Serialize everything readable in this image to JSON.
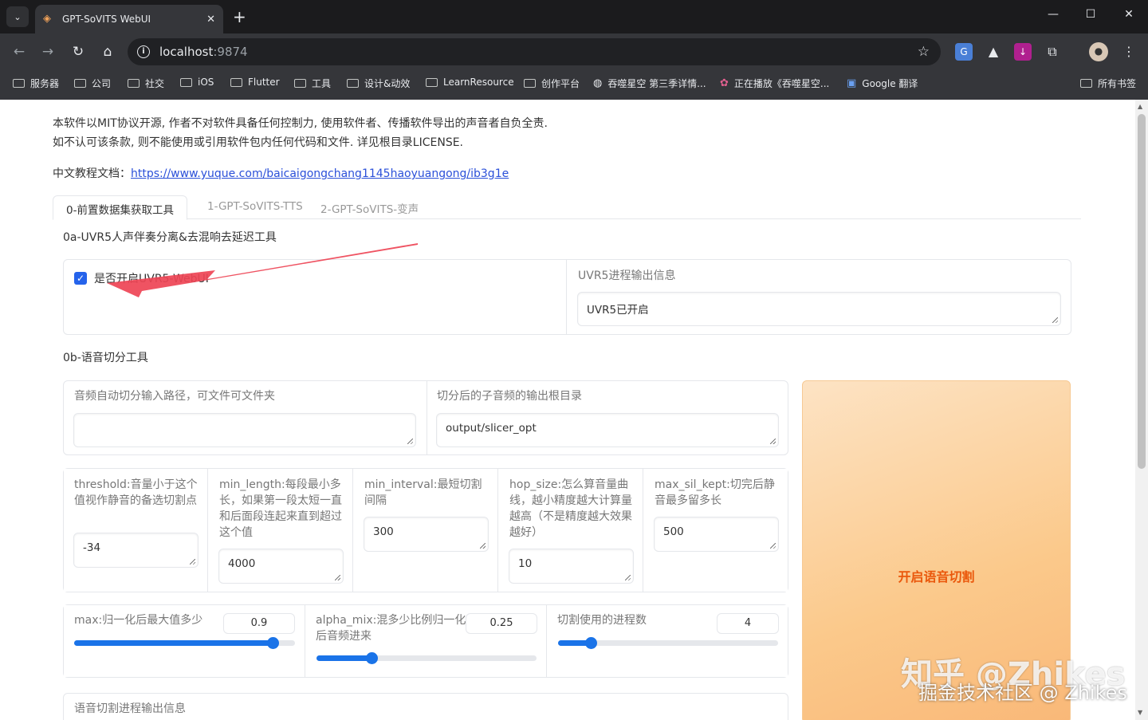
{
  "browser": {
    "tab_title": "GPT-SoVITS WebUI",
    "url_host": "localhost",
    "url_port": ":9874",
    "bookmarks": [
      "服务器",
      "公司",
      "社交",
      "iOS",
      "Flutter",
      "工具",
      "设计&动效",
      "LearnResource",
      "创作平台",
      "吞噬星空 第三季详情...",
      "正在播放《吞噬星空...",
      "Google 翻译"
    ],
    "all_bookmarks": "所有书签"
  },
  "page": {
    "license_line1": "本软件以MIT协议开源, 作者不对软件具备任何控制力, 使用软件者、传播软件导出的声音者自负全责.",
    "license_line2": "如不认可该条款, 则不能使用或引用软件包内任何代码和文件. 详见根目录LICENSE.",
    "doc_label": "中文教程文档：",
    "doc_link": "https://www.yuque.com/baicaigongchang1145haoyuangong/ib3g1e",
    "tabs": [
      "0-前置数据集获取工具",
      "1-GPT-SoVITS-TTS",
      "2-GPT-SoVITS-变声"
    ],
    "uvr": {
      "section_title": "0a-UVR5人声伴奏分离&去混响去延迟工具",
      "checkbox_label": "是否开启UVR5-WebUI",
      "output_label": "UVR5进程输出信息",
      "output_value": "UVR5已开启"
    },
    "slicer": {
      "section_title": "0b-语音切分工具",
      "input_path_label": "音频自动切分输入路径，可文件可文件夹",
      "input_path_value": "",
      "output_dir_label": "切分后的子音频的输出根目录",
      "output_dir_value": "output/slicer_opt",
      "params": [
        {
          "label": "threshold:音量小于这个值视作静音的备选切割点",
          "value": "-34"
        },
        {
          "label": "min_length:每段最小多长，如果第一段太短一直和后面段连起来直到超过这个值",
          "value": "4000"
        },
        {
          "label": "min_interval:最短切割间隔",
          "value": "300"
        },
        {
          "label": "hop_size:怎么算音量曲线，越小精度越大计算量越高（不是精度越大效果越好）",
          "value": "10"
        },
        {
          "label": "max_sil_kept:切完后静音最多留多长",
          "value": "500"
        }
      ],
      "sliders": [
        {
          "label": "max:归一化后最大值多少",
          "value": "0.9",
          "fraction": 0.9
        },
        {
          "label": "alpha_mix:混多少比例归一化后音频进来",
          "value": "0.25",
          "fraction": 0.25
        },
        {
          "label": "切割使用的进程数",
          "value": "4",
          "fraction": 0.15
        }
      ],
      "start_button": "开启语音切割",
      "progress_label": "语音切割进程输出信息"
    },
    "watermark_1": "知乎 @Zhikes",
    "watermark_2": "掘金技术社区 @ Zhikes"
  },
  "colors": {
    "accent": "#1a73e8",
    "button_text": "#ea580c",
    "annotation_arrow": "#ee4455"
  }
}
